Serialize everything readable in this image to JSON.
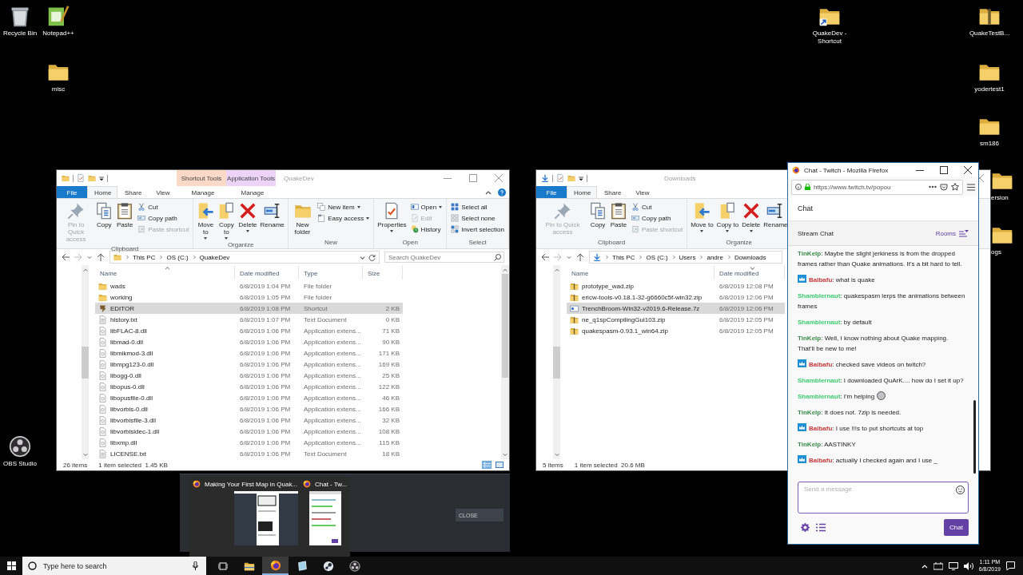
{
  "desktop_icons": [
    {
      "label": "Recycle Bin",
      "kind": "recycle"
    },
    {
      "label": "Notepad++",
      "kind": "notepad"
    },
    {
      "label": "misc",
      "kind": "folder"
    },
    {
      "label": "QuakeDev - Shortcut",
      "kind": "folder_shortcut"
    },
    {
      "label": "QuakeTestB...",
      "kind": "zip"
    },
    {
      "label": "yodertest1",
      "kind": "folder"
    },
    {
      "label": "sm186",
      "kind": "folder"
    },
    {
      "label": "ersion",
      "kind": "folder"
    },
    {
      "label": "ogs",
      "kind": "folder"
    },
    {
      "label": "OBS Studio",
      "kind": "obs"
    }
  ],
  "explorer_windows": [
    {
      "title": "QuakeDev",
      "context_tabs": [
        {
          "group": "Shortcut Tools",
          "tab": "Manage",
          "color": "#fbd9c7"
        },
        {
          "group": "Application Tools",
          "tab": "Manage",
          "color": "#ecd3f7"
        }
      ],
      "tabs": [
        {
          "label": "File",
          "kind": "file",
          "selected": false
        },
        {
          "label": "Home",
          "kind": "tab",
          "selected": true
        },
        {
          "label": "Share",
          "kind": "tab",
          "selected": false
        },
        {
          "label": "View",
          "kind": "tab",
          "selected": false
        }
      ],
      "ribbon_groups": [
        {
          "label": "Clipboard",
          "items": [
            {
              "label": "Pin to Quick access",
              "kind": "pin",
              "disabled": true,
              "dropdown": false
            },
            {
              "label": "Copy",
              "kind": "copy",
              "disabled": false,
              "dropdown": false
            },
            {
              "label": "Paste",
              "kind": "paste",
              "disabled": false,
              "dropdown": false
            },
            {
              "label": "Cut",
              "kind": "cut",
              "disabled": false,
              "dropdown": false
            },
            {
              "label": "Copy path",
              "kind": "copy_path",
              "disabled": false,
              "dropdown": false
            },
            {
              "label": "Paste shortcut",
              "kind": "paste_shortcut",
              "disabled": true,
              "dropdown": false
            }
          ]
        },
        {
          "label": "Organize",
          "items": [
            {
              "label": "Move to",
              "kind": "move",
              "disabled": false,
              "dropdown": true
            },
            {
              "label": "Copy to",
              "kind": "copy_to",
              "disabled": false,
              "dropdown": true
            },
            {
              "label": "Delete",
              "kind": "delete",
              "disabled": false,
              "dropdown": true
            },
            {
              "label": "Rename",
              "kind": "rename",
              "disabled": false,
              "dropdown": false
            }
          ]
        },
        {
          "label": "New",
          "items": [
            {
              "label": "New folder",
              "kind": "new_folder",
              "disabled": false,
              "dropdown": false
            },
            {
              "label": "New item",
              "kind": "new_item",
              "disabled": false,
              "dropdown": true
            },
            {
              "label": "Easy access",
              "kind": "easy_access",
              "disabled": false,
              "dropdown": true
            }
          ]
        },
        {
          "label": "Open",
          "items": [
            {
              "label": "Properties",
              "kind": "properties",
              "disabled": false,
              "dropdown": true
            },
            {
              "label": "Open",
              "kind": "open",
              "disabled": false,
              "dropdown": true
            },
            {
              "label": "Edit",
              "kind": "edit",
              "disabled": true,
              "dropdown": false
            },
            {
              "label": "History",
              "kind": "history",
              "disabled": false,
              "dropdown": false
            }
          ]
        },
        {
          "label": "Select",
          "items": [
            {
              "label": "Select all",
              "kind": "select_all",
              "disabled": false,
              "dropdown": false
            },
            {
              "label": "Select none",
              "kind": "select_none",
              "disabled": false,
              "dropdown": false
            },
            {
              "label": "Invert selection",
              "kind": "invert",
              "disabled": false,
              "dropdown": false
            }
          ]
        }
      ],
      "breadcrumb": [
        "This PC",
        "OS (C:)",
        "QuakeDev"
      ],
      "search": {
        "placeholder": "Search QuakeDev"
      },
      "columns": [
        {
          "label": "Name",
          "sorted": true
        },
        {
          "label": "Date modified",
          "sorted": false
        },
        {
          "label": "Type",
          "sorted": false
        },
        {
          "label": "Size",
          "sorted": false
        }
      ],
      "rows": [
        {
          "name": "wads",
          "kind": "folder",
          "date": "6/8/2019 1:04 PM",
          "type": "File folder",
          "selected": false
        },
        {
          "name": "working",
          "kind": "folder",
          "date": "6/8/2019 1:05 PM",
          "type": "File folder",
          "selected": false
        },
        {
          "name": "EDITOR",
          "kind": "shortcut",
          "date": "6/8/2019 1:08 PM",
          "type": "Shortcut",
          "size": "2 KB",
          "selected": true
        },
        {
          "name": "history.txt",
          "kind": "text",
          "date": "6/8/2019 1:07 PM",
          "type": "Text Document",
          "size": "0 KB",
          "selected": false
        },
        {
          "name": "libFLAC-8.dll",
          "kind": "dll",
          "date": "6/8/2019 1:06 PM",
          "type": "Application extens...",
          "size": "71 KB",
          "selected": false
        },
        {
          "name": "libmad-0.dll",
          "kind": "dll",
          "date": "6/8/2019 1:06 PM",
          "type": "Application extens...",
          "size": "90 KB",
          "selected": false
        },
        {
          "name": "libmikmod-3.dll",
          "kind": "dll",
          "date": "6/8/2019 1:06 PM",
          "type": "Application extens...",
          "size": "171 KB",
          "selected": false
        },
        {
          "name": "libmpg123-0.dll",
          "kind": "dll",
          "date": "6/8/2019 1:06 PM",
          "type": "Application extens...",
          "size": "169 KB",
          "selected": false
        },
        {
          "name": "libogg-0.dll",
          "kind": "dll",
          "date": "6/8/2019 1:06 PM",
          "type": "Application extens...",
          "size": "25 KB",
          "selected": false
        },
        {
          "name": "libopus-0.dll",
          "kind": "dll",
          "date": "6/8/2019 1:06 PM",
          "type": "Application extens...",
          "size": "122 KB",
          "selected": false
        },
        {
          "name": "libopusfile-0.dll",
          "kind": "dll",
          "date": "6/8/2019 1:06 PM",
          "type": "Application extens...",
          "size": "46 KB",
          "selected": false
        },
        {
          "name": "libvorbis-0.dll",
          "kind": "dll",
          "date": "6/8/2019 1:06 PM",
          "type": "Application extens...",
          "size": "166 KB",
          "selected": false
        },
        {
          "name": "libvorbisfile-3.dll",
          "kind": "dll",
          "date": "6/8/2019 1:06 PM",
          "type": "Application extens...",
          "size": "32 KB",
          "selected": false
        },
        {
          "name": "libvorbisidec-1.dll",
          "kind": "dll",
          "date": "6/8/2019 1:06 PM",
          "type": "Application extens...",
          "size": "108 KB",
          "selected": false
        },
        {
          "name": "libxmp.dll",
          "kind": "dll",
          "date": "6/8/2019 1:06 PM",
          "type": "Application extens...",
          "size": "115 KB",
          "selected": false
        },
        {
          "name": "LICENSE.txt",
          "kind": "text",
          "date": "6/8/2019 1:06 PM",
          "type": "Text Document",
          "size": "18 KB",
          "selected": false
        }
      ],
      "status": {
        "count": "26 items",
        "selection": "1 item selected  1.45 KB"
      }
    },
    {
      "title": "Downloads",
      "tabs": [
        {
          "label": "File",
          "kind": "file",
          "selected": false
        },
        {
          "label": "Home",
          "kind": "tab",
          "selected": true
        },
        {
          "label": "Share",
          "kind": "tab",
          "selected": false
        },
        {
          "label": "View",
          "kind": "tab",
          "selected": false
        }
      ],
      "ribbon_groups": [
        {
          "label": "Clipboard",
          "items": [
            {
              "label": "Pin to Quick access",
              "kind": "pin",
              "disabled": true,
              "dropdown": false
            },
            {
              "label": "Copy",
              "kind": "copy",
              "disabled": false,
              "dropdown": false
            },
            {
              "label": "Paste",
              "kind": "paste",
              "disabled": false,
              "dropdown": false
            },
            {
              "label": "Cut",
              "kind": "cut",
              "disabled": false,
              "dropdown": false
            },
            {
              "label": "Copy path",
              "kind": "copy_path",
              "disabled": false,
              "dropdown": false
            },
            {
              "label": "Paste shortcut",
              "kind": "paste_shortcut",
              "disabled": true,
              "dropdown": false
            }
          ]
        },
        {
          "label": "Organize",
          "items": [
            {
              "label": "Move to",
              "kind": "move",
              "disabled": false,
              "dropdown": true
            },
            {
              "label": "Copy to",
              "kind": "copy_to",
              "disabled": false,
              "dropdown": true
            },
            {
              "label": "Delete",
              "kind": "delete",
              "disabled": false,
              "dropdown": true
            },
            {
              "label": "Rename",
              "kind": "rename",
              "disabled": false,
              "dropdown": false
            }
          ]
        }
      ],
      "breadcrumb": [
        "This PC",
        "OS (C:)",
        "Users",
        "andre",
        "Downloads"
      ],
      "columns": [
        {
          "label": "Name",
          "sorted": false
        },
        {
          "label": "Date modified",
          "sorted": true
        }
      ],
      "rows": [
        {
          "name": "prototype_wad.zip",
          "kind": "zip",
          "date": "6/8/2019 12:08 PM",
          "selected": false
        },
        {
          "name": "ericw-tools-v0.18.1-32-g6660c5f-win32.zip",
          "kind": "zip",
          "date": "6/8/2019 12:06 PM",
          "selected": false
        },
        {
          "name": "TrenchBroom-Win32-v2019.6-Release.7z",
          "kind": "archive",
          "date": "6/8/2019 12:06 PM",
          "selected": true
        },
        {
          "name": "ne_q1spCompilingGui103.zip",
          "kind": "zip",
          "date": "6/8/2019 12:05 PM",
          "selected": false
        },
        {
          "name": "quakespasm-0.93.1_win64.zip",
          "kind": "zip",
          "date": "6/8/2019 12:05 PM",
          "selected": false
        }
      ],
      "status": {
        "count": "5 items",
        "selection": "1 item selected  20.6 MB"
      }
    }
  ],
  "switcher": {
    "close_button": "CLOSE",
    "thumbnails": [
      {
        "title": "Making Your First Map in Quak...",
        "kind": "wide"
      },
      {
        "title": "Chat - Tw...",
        "kind": "narrow"
      }
    ]
  },
  "chat_window": {
    "title": "Chat - Twitch - Mozilla Firefox",
    "url": "https://www.twitch.tv/popou",
    "header": "Chat",
    "room": "Stream Chat",
    "rooms_button": "Rooms",
    "messages": [
      {
        "user": "TinKelp",
        "color": "#3d8a4a",
        "badge": false,
        "text": ": Maybe the slight jerkiness is from the dropped frames rather than Quake animations. It's a bit hard to tell.",
        "emote": false
      },
      {
        "user": "Balbafu",
        "color": "#c8383a",
        "badge": true,
        "text": ": what is quake",
        "emote": false
      },
      {
        "user": "Shamblernaut",
        "color": "#3ecb6f",
        "badge": false,
        "text": ": quakespasm lerps the animations between frames",
        "emote": false
      },
      {
        "user": "Shamblernaut",
        "color": "#3ecb6f",
        "badge": false,
        "text": ": by default",
        "emote": false
      },
      {
        "user": "TinKelp",
        "color": "#3d8a4a",
        "badge": false,
        "text": ": Well, I know nothing about Quake mapping. That'll be new to me!",
        "emote": false
      },
      {
        "user": "Balbafu",
        "color": "#c8383a",
        "badge": true,
        "text": ": checked save videos on twitch?",
        "emote": false
      },
      {
        "user": "Shamblernaut",
        "color": "#3ecb6f",
        "badge": false,
        "text": ": I downloaded QuArK.... how do I set it up?",
        "emote": false
      },
      {
        "user": "Shamblernaut",
        "color": "#3ecb6f",
        "badge": false,
        "text": ": I'm helping",
        "emote": true
      },
      {
        "user": "TinKelp",
        "color": "#3d8a4a",
        "badge": false,
        "text": ": It does not. 7zip is needed.",
        "emote": false
      },
      {
        "user": "Balbafu",
        "color": "#c8383a",
        "badge": true,
        "text": ": I use !!!s to put shortcuts at top",
        "emote": false
      },
      {
        "user": "TinKelp",
        "color": "#3d8a4a",
        "badge": false,
        "text": ": AASTINKY",
        "emote": false
      },
      {
        "user": "Balbafu",
        "color": "#c8383a",
        "badge": true,
        "text": ": actually I checked again and I use _",
        "emote": false
      }
    ],
    "input": {
      "placeholder": "Send a message"
    },
    "send_button": "Chat"
  },
  "taskbar": {
    "search": {
      "placeholder": "Type here to search"
    },
    "apps": [
      {
        "kind": "explorer",
        "selected": false
      },
      {
        "kind": "firefox",
        "selected": true
      },
      {
        "kind": "card",
        "selected": false
      },
      {
        "kind": "steam",
        "selected": false
      },
      {
        "kind": "obs",
        "selected": false
      }
    ],
    "time": "1:11 PM",
    "date": "6/8/2019"
  }
}
